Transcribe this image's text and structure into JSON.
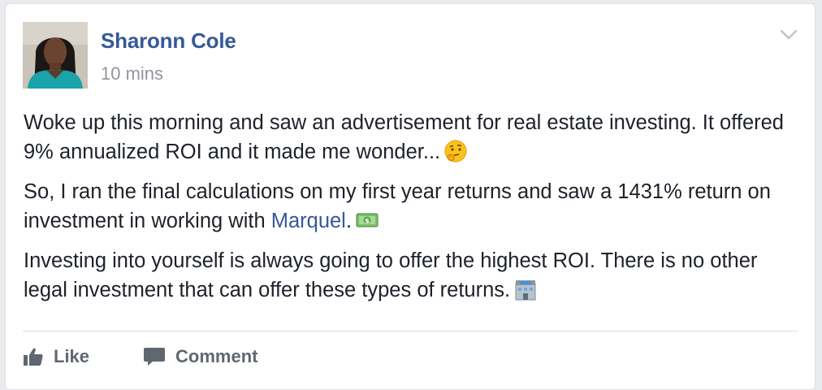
{
  "post": {
    "author": "Sharonn Cole",
    "timestamp": "10 mins",
    "paragraphs": [
      {
        "text": "Woke up this morning and saw an advertisement for real estate investing. It offered 9% annualized ROI and it made me wonder...",
        "emoji": "thinking-face-emoji"
      },
      {
        "text_before": "So, I ran the final calculations on my first year returns and saw a 1431% return on investment in working with ",
        "mention": "Marquel",
        "text_after": ".",
        "emoji": "dollar-banknote-emoji"
      },
      {
        "text": "Investing into yourself is always going to offer the highest ROI. There is no other legal investment that can offer these types of returns.",
        "emoji": "bank-emoji"
      }
    ],
    "menu_icon": "chevron-down-icon"
  },
  "actions": {
    "like_label": "Like",
    "comment_label": "Comment",
    "like_icon": "thumbs-up-icon",
    "comment_icon": "comment-bubble-icon"
  },
  "colors": {
    "link": "#365899",
    "text": "#1d2129",
    "muted": "#90949c",
    "action": "#606770",
    "background": "#e9ebee"
  }
}
